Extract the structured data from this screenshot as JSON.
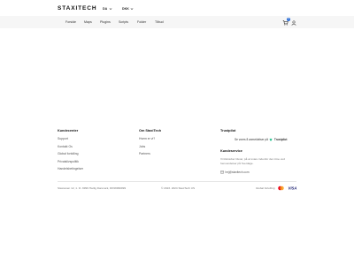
{
  "header": {
    "logo": "STAXITECH",
    "language": "DA",
    "currency": "DKK"
  },
  "nav": {
    "items": [
      "Forside",
      "Maps",
      "Plugins",
      "Scripts",
      "Folder",
      "Tilbud"
    ],
    "cart_count": "0"
  },
  "footer": {
    "col1": {
      "title": "Kundecenter",
      "links": [
        "Support",
        "Kontakt Os",
        "Global fortolling",
        "Privatslivspolitik",
        "Handelsbetingelser"
      ]
    },
    "col2": {
      "title": "Om StaxiTech",
      "links": [
        "Hvem er vi?",
        "Jobs",
        "Partners"
      ]
    },
    "col3": {
      "title": "Trustpilot",
      "trust_text": "Se vores 8 anmeldelser på",
      "trust_brand": "Trustpilot",
      "service_title": "Kundeservice",
      "service_text": "Vi tilstræber tilsvar, på at svare indenfor den time ved henvendelser på hverdage.",
      "email": "hej@staxitech.com"
    }
  },
  "bottom": {
    "address": "Staxiveien 12, 1. th. 9999 Harlig Danmark, DK99999999",
    "copyright": "© 2023. 2024 StaxiTech US",
    "global": "Global fortolling",
    "payment_icons": [
      "mastercard-icon",
      "visa-icon"
    ],
    "visa_label": "VISA"
  },
  "colors": {
    "accent": "#2f6fd6",
    "nav_bg": "#f6f6f6",
    "trust_green": "#00b67a"
  }
}
